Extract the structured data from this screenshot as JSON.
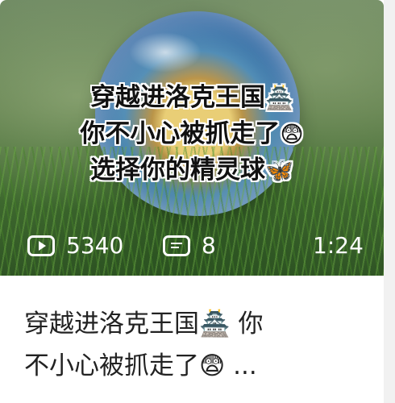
{
  "thumbnail": {
    "overlay_lines": [
      {
        "text": "穿越进洛克王国",
        "emoji": "🏯"
      },
      {
        "text": "你不小心被抓走了",
        "emoji": "😨"
      },
      {
        "text": "选择你的精灵球",
        "emoji": "🦋"
      }
    ],
    "stats": {
      "views": "5340",
      "comments": "8",
      "duration": "1:24"
    }
  },
  "card_title": {
    "line1": "穿越进洛克王国🏯 你",
    "line2": "不小心被抓走了😨 ..."
  },
  "icons": {
    "views_icon": "play-icon",
    "comments_icon": "comment-icon"
  }
}
